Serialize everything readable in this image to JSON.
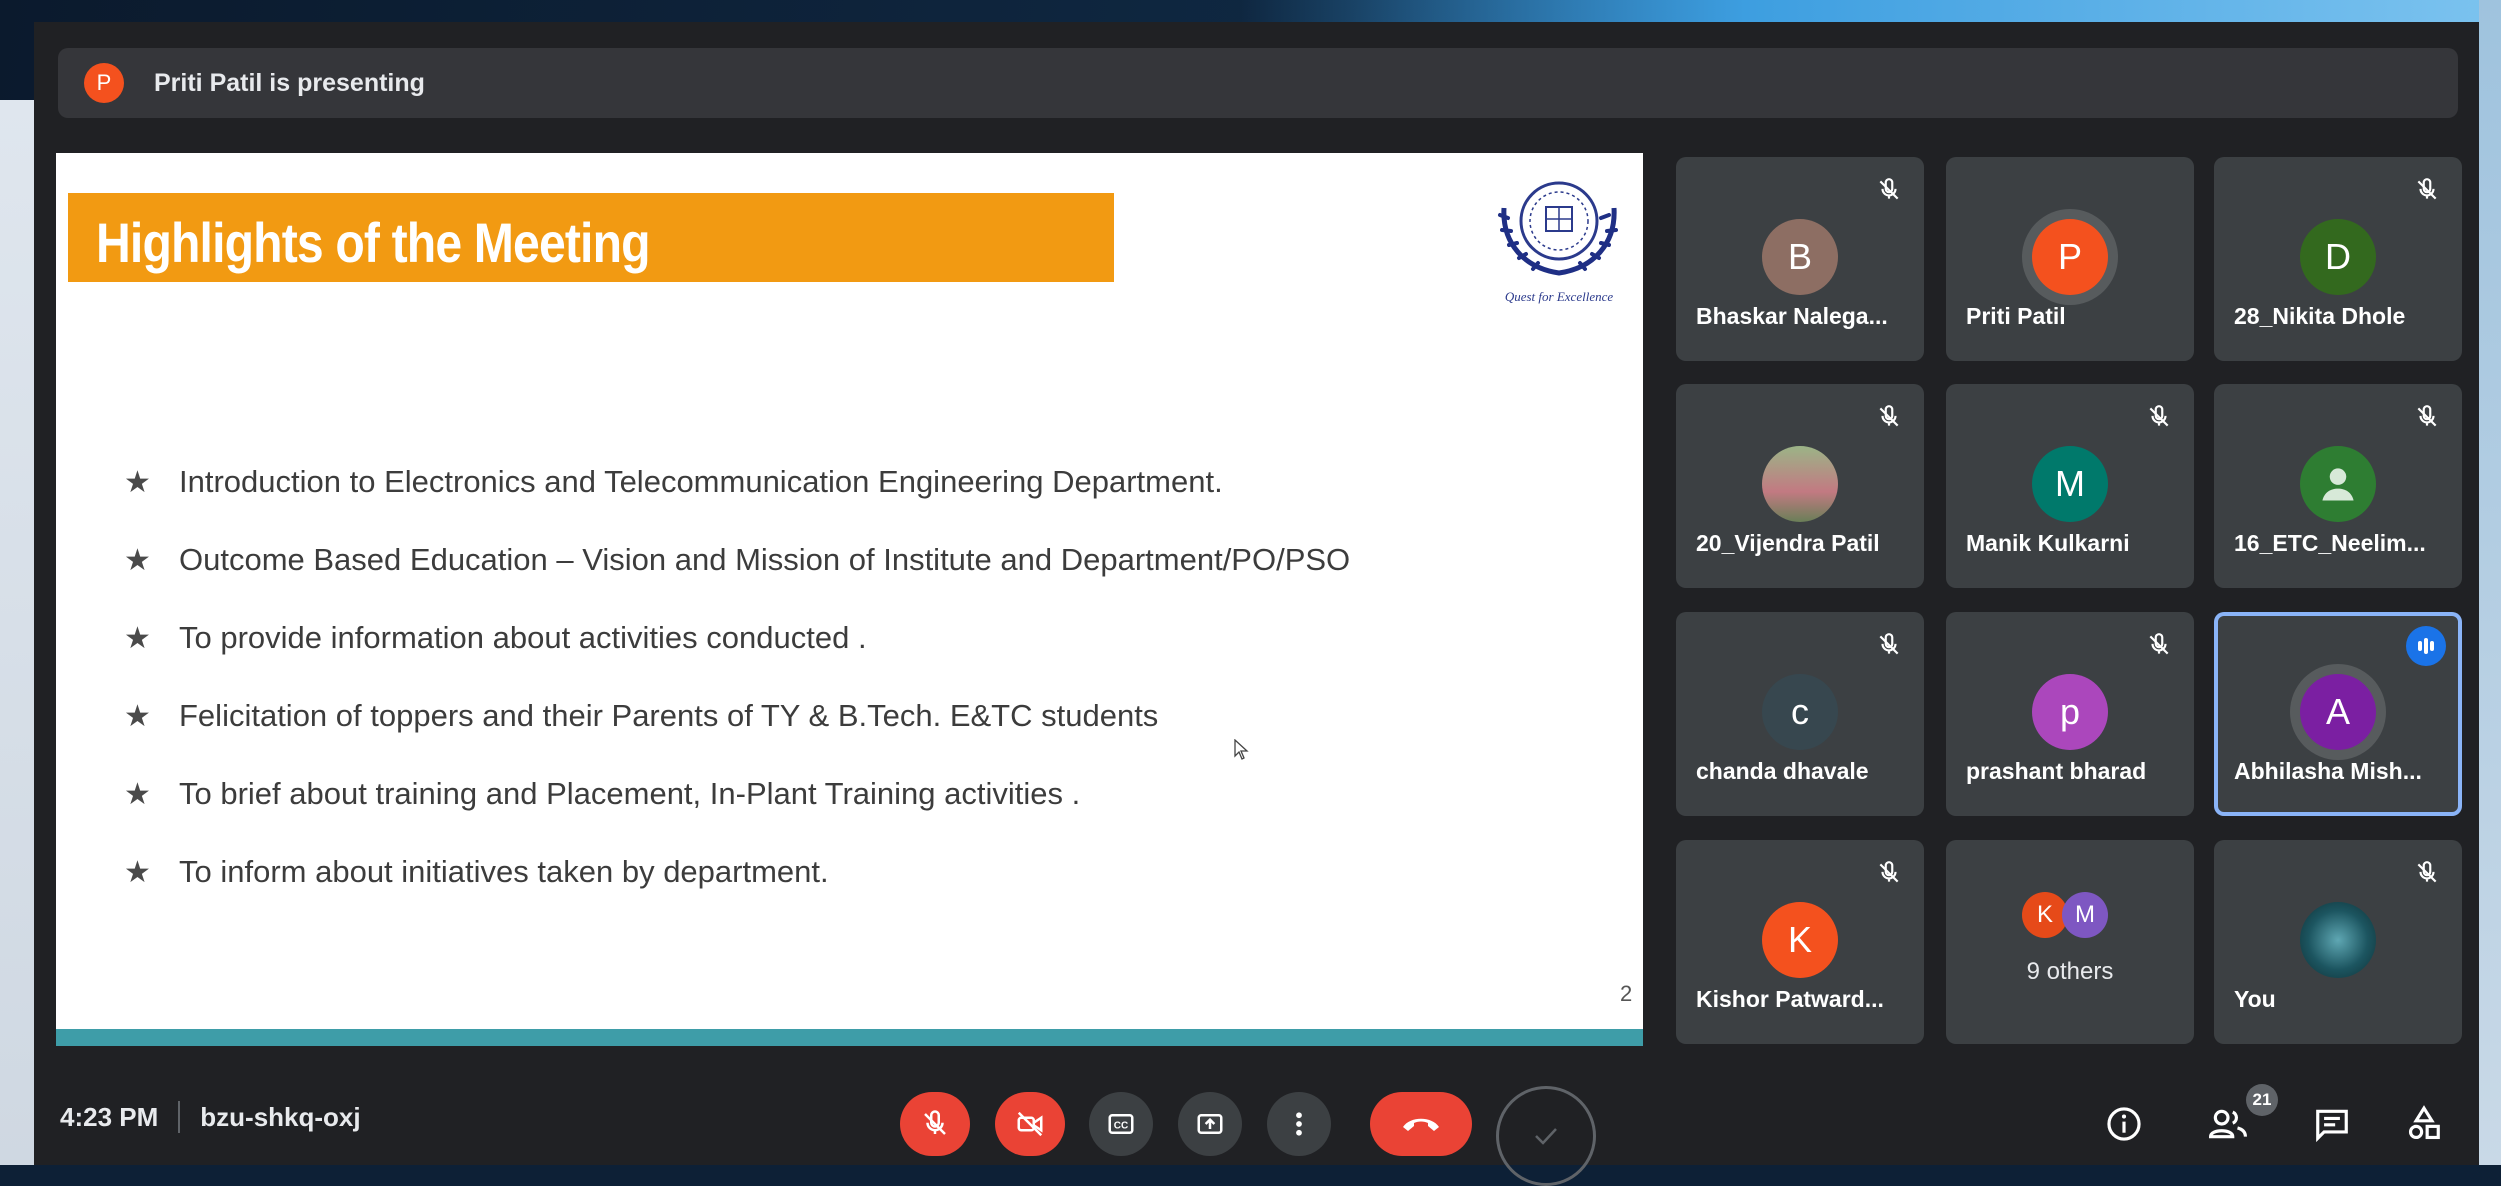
{
  "presenting_bar": {
    "avatar_letter": "P",
    "text": "Priti Patil is presenting"
  },
  "slide": {
    "title": "Highlights of the Meeting",
    "logo_caption": "Quest for Excellence",
    "bullets": [
      "Introduction to Electronics and Telecommunication Engineering Department.",
      "Outcome Based Education – Vision and Mission of Institute and Department/PO/PSO",
      "To provide information about activities conducted .",
      "Felicitation of toppers and  their Parents of TY  & B.Tech.  E&TC students",
      "To brief about training and Placement, In-Plant Training activities .",
      "To inform about initiatives taken by department."
    ],
    "page_number": "2",
    "bullet_glyph": "★"
  },
  "participants": [
    {
      "letter": "B",
      "name": "Bhaskar Nalega...",
      "color": "#8d6e63"
    },
    {
      "letter": "P",
      "name": "Priti Patil",
      "color": "#f4511e"
    },
    {
      "letter": "D",
      "name": "28_Nikita Dhole",
      "color": "#33691e"
    },
    {
      "letter": "",
      "name": "20_Vijendra Patil",
      "color": "#7d8f6a"
    },
    {
      "letter": "M",
      "name": "Manik Kulkarni",
      "color": "#00796b"
    },
    {
      "letter": "",
      "name": "16_ETC_Neelim...",
      "color": "#2e7d32"
    },
    {
      "letter": "c",
      "name": "chanda dhavale",
      "color": "#37474f"
    },
    {
      "letter": "p",
      "name": "prashant bharad",
      "color": "#ab47bc"
    },
    {
      "letter": "A",
      "name": "Abhilasha Mish...",
      "color": "#7b1fa2"
    },
    {
      "letter": "K",
      "name": "Kishor Patward...",
      "color": "#f4511e"
    },
    {
      "letter": "",
      "name": "You",
      "color": "#1c5560"
    }
  ],
  "others_tile": {
    "letters": [
      "K",
      "M"
    ],
    "colors": [
      "#e64a19",
      "#7e57c2"
    ],
    "text": "9 others"
  },
  "bottom_bar": {
    "time": "4:23 PM",
    "meeting_code": "bzu-shkq-oxj",
    "participant_count": "21"
  }
}
